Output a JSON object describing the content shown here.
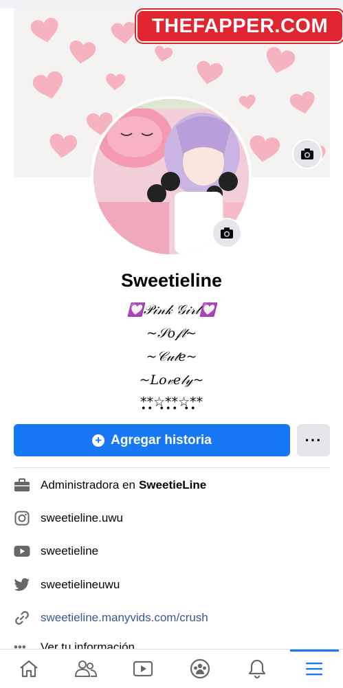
{
  "watermark": {
    "text": "THEFAPPER.COM"
  },
  "profile": {
    "name": "Sweetieline",
    "bio": {
      "line1": "💟𝒫𝒾𝓃𝓀 𝒢𝒾𝓇𝓁💟",
      "line2": "~𝒮𝑜𝒻𝓉~",
      "line3": "~𝒞𝓊𝓉𝑒~",
      "line4": "~𝐿𝑜𝓋𝑒𝓁𝓎~",
      "line5": "*̣̣̥*̣̣̥☆̣̥*̣̣̥*̣̣̥☆̣̥*̣̣̥*"
    }
  },
  "actions": {
    "add_story_label": "Agregar historia",
    "more_label": "···"
  },
  "info": {
    "work_prefix": "Administradora en",
    "work_company": "SweetieLine",
    "instagram": "sweetieline.uwu",
    "youtube": "sweetieline",
    "twitter": "sweetielineuwu",
    "website": "sweetieline.manyvids.com/crush",
    "see_info": "Ver tu información"
  },
  "colors": {
    "accent": "#1877f2",
    "watermark": "#e02430",
    "link": "#385898"
  },
  "nav": [
    {
      "icon": "home-icon"
    },
    {
      "icon": "friends-icon"
    },
    {
      "icon": "watch-icon"
    },
    {
      "icon": "groups-icon"
    },
    {
      "icon": "notifications-icon"
    },
    {
      "icon": "menu-icon",
      "active": true
    }
  ]
}
